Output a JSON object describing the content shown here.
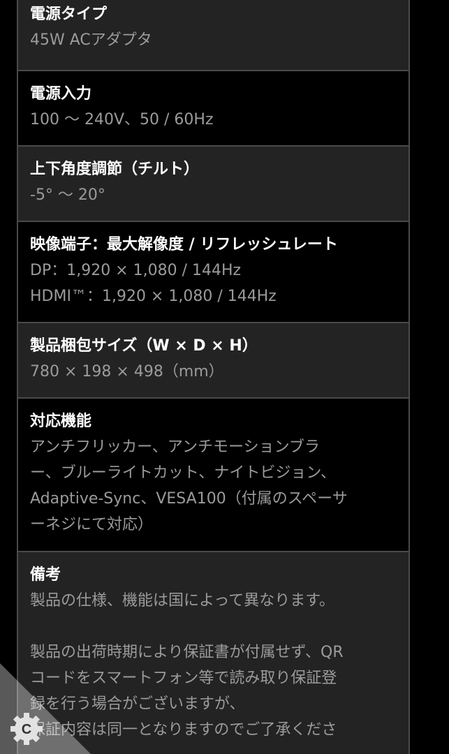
{
  "specs": [
    {
      "label": "電源タイプ",
      "lines": [
        "45W ACアダプタ"
      ]
    },
    {
      "label": "電源入力",
      "lines": [
        "100 〜 240V、50 / 60Hz"
      ]
    },
    {
      "label": "上下角度調節（チルト）",
      "lines": [
        "-5° 〜 20°"
      ]
    },
    {
      "label": "映像端子：最大解像度 / リフレッシュレート",
      "lines": [
        "DP：1,920 × 1,080 / 144Hz",
        "HDMI™：1,920 × 1,080 / 144Hz"
      ]
    },
    {
      "label": "製品梱包サイズ（W × D × H）",
      "lines": [
        "780 × 198 × 498（mm）"
      ]
    },
    {
      "label": "対応機能",
      "lines": [
        "アンチフリッカー、アンチモーションブラ",
        "ー、ブルーライトカット、ナイトビジョン、",
        "Adaptive-Sync、VESA100（付属のスペーサ",
        "ーネジにて対応）"
      ]
    },
    {
      "label": "備考",
      "lines": [
        "製品の仕様、機能は国によって異なります。",
        "",
        "製品の出荷時期により保証書が付属せず、QR",
        "コードをスマートフォン等で読み取り保証登",
        "録を行う場合がございますが、",
        "保証内容は同一となりますのでご了承くださ"
      ]
    }
  ],
  "badge": {
    "icon": "gear-c-icon",
    "letter": "C",
    "color": "#d9d9d9"
  }
}
